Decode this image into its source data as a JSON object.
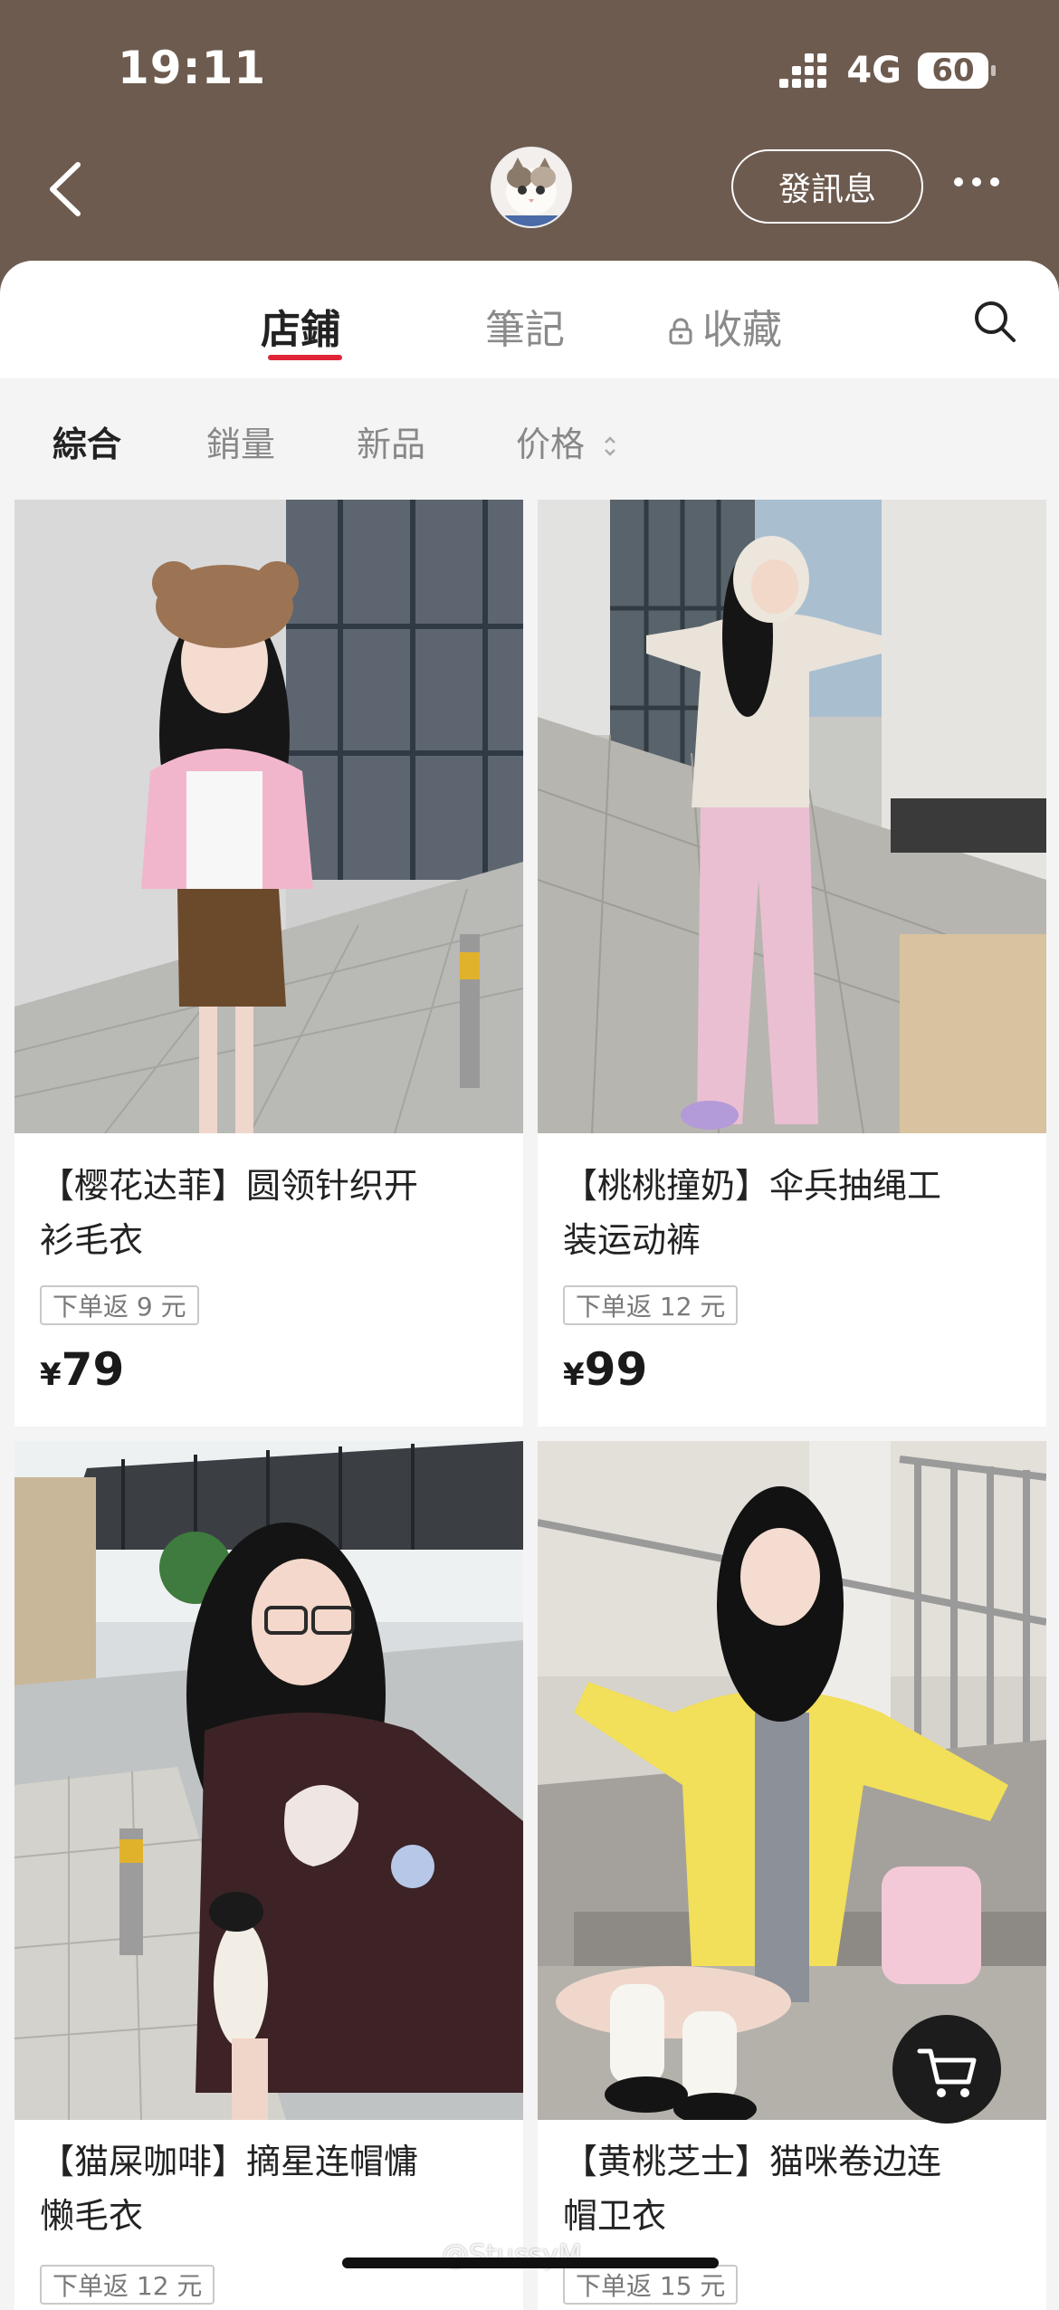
{
  "status_bar": {
    "time": "19:11",
    "network": "4G",
    "battery": "60"
  },
  "header": {
    "message_button": "發訊息"
  },
  "tabs": [
    {
      "label": "店鋪",
      "active": true
    },
    {
      "label": "筆記",
      "active": false
    },
    {
      "label": "收藏",
      "active": false,
      "locked": true
    }
  ],
  "sort_options": [
    {
      "label": "綜合",
      "active": true
    },
    {
      "label": "銷量",
      "active": false
    },
    {
      "label": "新品",
      "active": false
    },
    {
      "label": "价格",
      "active": false,
      "has_sort_arrows": true
    }
  ],
  "products": [
    {
      "title": "【樱花达菲】圆领针织开\n衫毛衣",
      "rebate": "下单返 9 元",
      "currency": "¥",
      "price": "79"
    },
    {
      "title": "【桃桃撞奶】伞兵抽绳工\n装运动裤",
      "rebate": "下单返 12 元",
      "currency": "¥",
      "price": "99"
    },
    {
      "title": "【猫屎咖啡】摘星连帽慵\n懒毛衣",
      "rebate": "下单返 12 元",
      "currency": "¥",
      "price": ""
    },
    {
      "title": "【黄桃芝士】猫咪卷边连\n帽卫衣",
      "rebate": "下单返 15 元",
      "currency": "¥",
      "price": ""
    }
  ],
  "watermark": "@StussyM",
  "colors": {
    "header_bg": "#6e5b4f",
    "accent_red": "#e02437",
    "page_bg": "#f4f4f4"
  }
}
